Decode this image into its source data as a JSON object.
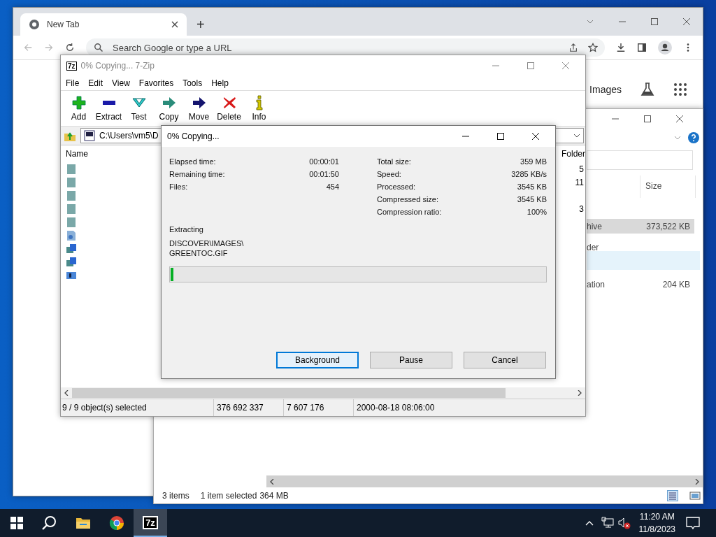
{
  "chrome": {
    "tab": "New Tab",
    "new_tab": "+",
    "omnibox_placeholder": "Search Google or type a URL",
    "links": [
      "Images"
    ]
  },
  "explorer": {
    "column": "Size",
    "rows": [
      {
        "name": "hive",
        "size": "373,522 KB",
        "selected": true
      },
      {
        "name": "der",
        "selected": false
      },
      {
        "name": "ation",
        "size": "204 KB",
        "selected": false
      }
    ],
    "status": [
      "3 items",
      "1 item selected",
      "364 MB"
    ]
  },
  "sevenzip": {
    "app_icon": "7z",
    "title": "0% Copying... 7-Zip",
    "menu": [
      "File",
      "Edit",
      "View",
      "Favorites",
      "Tools",
      "Help"
    ],
    "toolbar": [
      {
        "label": "Add",
        "kind": "add"
      },
      {
        "label": "Extract",
        "kind": "extract"
      },
      {
        "label": "Test",
        "kind": "test"
      },
      {
        "label": "Copy",
        "kind": "copy"
      },
      {
        "label": "Move",
        "kind": "move"
      },
      {
        "label": "Delete",
        "kind": "delete"
      },
      {
        "label": "Info",
        "kind": "info"
      }
    ],
    "path": "C:\\Users\\vm5\\D",
    "columns": [
      "Name",
      "Folder"
    ],
    "items": [
      {
        "kind": "folder",
        "folders": "5"
      },
      {
        "kind": "folder",
        "folders": "11"
      },
      {
        "kind": "folder"
      },
      {
        "kind": "folder",
        "folders": "3"
      },
      {
        "kind": "folder"
      },
      {
        "kind": "document"
      },
      {
        "kind": "program"
      },
      {
        "kind": "program"
      },
      {
        "kind": "window"
      }
    ],
    "status": [
      "9 / 9 object(s) selected",
      "376 692 337",
      "7 607 176",
      "2000-08-18 08:06:00"
    ]
  },
  "dialog": {
    "title": "0% Copying...",
    "left": [
      {
        "label": "Elapsed time:",
        "value": "00:00:01"
      },
      {
        "label": "Remaining time:",
        "value": "00:01:50"
      },
      {
        "label": "Files:",
        "value": "454"
      }
    ],
    "right": [
      {
        "label": "Total size:",
        "value": "359 MB"
      },
      {
        "label": "Speed:",
        "value": "3285 KB/s"
      },
      {
        "label": "Processed:",
        "value": "3545 KB"
      },
      {
        "label": "Compressed size:",
        "value": "3545 KB"
      },
      {
        "label": "Compression ratio:",
        "value": "100%"
      }
    ],
    "action": "Extracting",
    "path_lines": [
      "DISCOVER\\IMAGES\\",
      "GREENTOC.GIF"
    ],
    "progress": {
      "level": 0.008
    },
    "buttons": [
      {
        "label": "Background",
        "selected": true
      },
      {
        "label": "Pause",
        "selected": false
      },
      {
        "label": "Cancel",
        "selected": false
      }
    ]
  },
  "taskbar": {
    "apps": [
      {
        "kind": "search",
        "selected": false
      },
      {
        "kind": "explorer",
        "selected": false
      },
      {
        "kind": "chrome",
        "selected": false
      },
      {
        "kind": "sevenzip",
        "label": "7z",
        "selected": true
      }
    ],
    "time": "11:20 AM",
    "date": "11/8/2023"
  }
}
